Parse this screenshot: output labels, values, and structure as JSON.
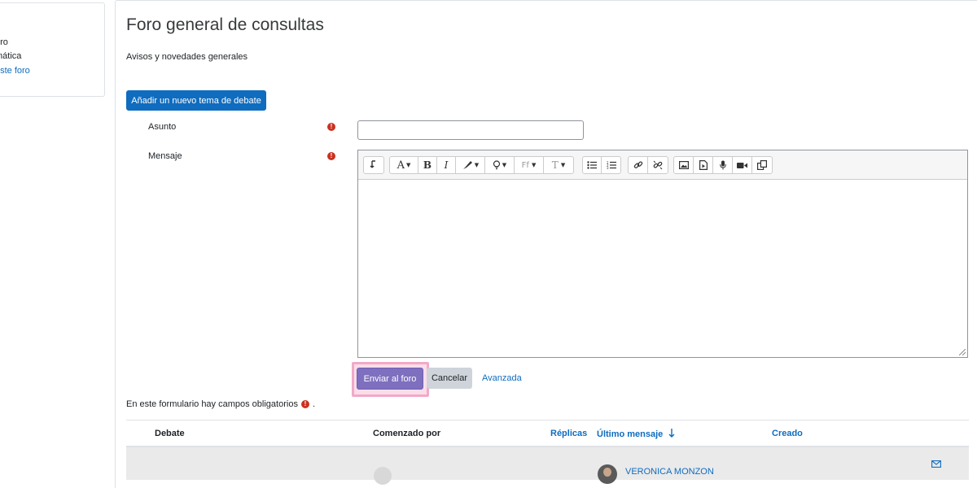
{
  "sidebar": {
    "items": [
      {
        "label": "oro",
        "link": false
      },
      {
        "label": "mática",
        "link": false
      },
      {
        "label": "este foro",
        "link": true
      }
    ]
  },
  "page": {
    "title": "Foro general de consultas",
    "intro": "Avisos y novedades generales"
  },
  "add_button": {
    "label": "Añadir un nuevo tema de debate"
  },
  "form": {
    "subject_label": "Asunto",
    "subject_value": "",
    "message_label": "Mensaje",
    "required_icon": "exclamation-circle-icon",
    "toolbar": {
      "groups": [
        [
          "collapse-icon"
        ],
        [
          "font-color-icon",
          "bold-icon",
          "italic-icon",
          "background-color-icon",
          "lightbulb-icon",
          "font-family-icon",
          "font-size-icon"
        ],
        [
          "unordered-list-icon",
          "ordered-list-icon"
        ],
        [
          "link-icon",
          "unlink-icon"
        ],
        [
          "image-icon",
          "media-icon",
          "record-audio-icon",
          "record-video-icon",
          "manage-files-icon"
        ]
      ]
    },
    "submit_label": "Enviar al foro",
    "cancel_label": "Cancelar",
    "advanced_label": "Avanzada",
    "required_note": "En este formulario hay campos obligatorios",
    "required_note_end": "."
  },
  "table": {
    "headers": {
      "debate": "Debate",
      "started_by": "Comenzado por",
      "replies": "Réplicas",
      "last_post": "Último mensaje",
      "created": "Creado"
    },
    "sort_icon": "arrow-down-icon",
    "rows": [
      {
        "last_post_author": "VERONICA MONZON"
      }
    ]
  },
  "colors": {
    "primary": "#0f6cbf",
    "submit": "#7e6fbf",
    "highlight": "#f2a9c8",
    "required": "#ca3120"
  }
}
